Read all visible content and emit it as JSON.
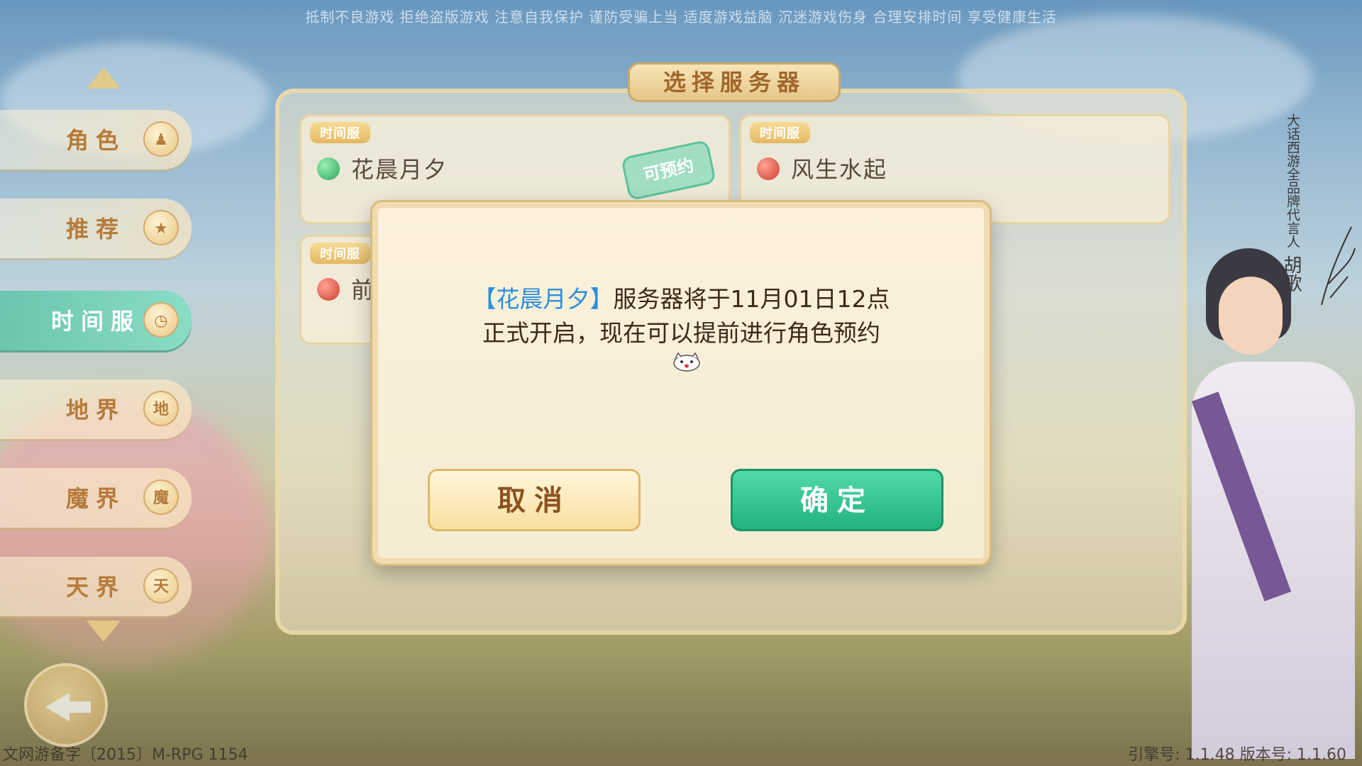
{
  "notice": "抵制不良游戏 拒绝盗版游戏 注意自我保护 谨防受骗上当 适度游戏益脑 沉迷游戏伤身 合理安排时间 享受健康生活",
  "sidebar": {
    "items": [
      {
        "label": "角色",
        "badge": "",
        "active": false
      },
      {
        "label": "推荐",
        "badge": "",
        "active": false
      },
      {
        "label": "时间服",
        "badge": "",
        "active": true
      },
      {
        "label": "地界",
        "badge": "地",
        "active": false
      },
      {
        "label": "魔界",
        "badge": "魔",
        "active": false
      },
      {
        "label": "天界",
        "badge": "天",
        "active": false
      }
    ]
  },
  "panel": {
    "title": "选择服务器",
    "servers": [
      {
        "tag": "时间服",
        "name": "花晨月夕",
        "status": "green",
        "stamp": "可预约"
      },
      {
        "tag": "时间服",
        "name": "风生水起",
        "status": "red",
        "stamp": ""
      },
      {
        "tag": "时间服",
        "name": "前",
        "status": "red",
        "stamp": ""
      }
    ]
  },
  "dialog": {
    "server_highlight": "【花晨月夕】",
    "message_line1_rest": "服务器将于11月01日12点",
    "message_line2": "正式开启，现在可以提前进行角色预约",
    "cancel_label": "取消",
    "confirm_label": "确定"
  },
  "spokesperson": {
    "caption": "大话西游全品牌代言人",
    "name": "胡歌"
  },
  "footer": {
    "license": "文网游备字〔2015〕M-RPG 1154",
    "version": "引擎号: 1.1.48  版本号: 1.1.60"
  },
  "colors": {
    "accent_green": "#22b37e",
    "highlight_blue": "#2d8fd8",
    "gold": "#e2b356"
  }
}
